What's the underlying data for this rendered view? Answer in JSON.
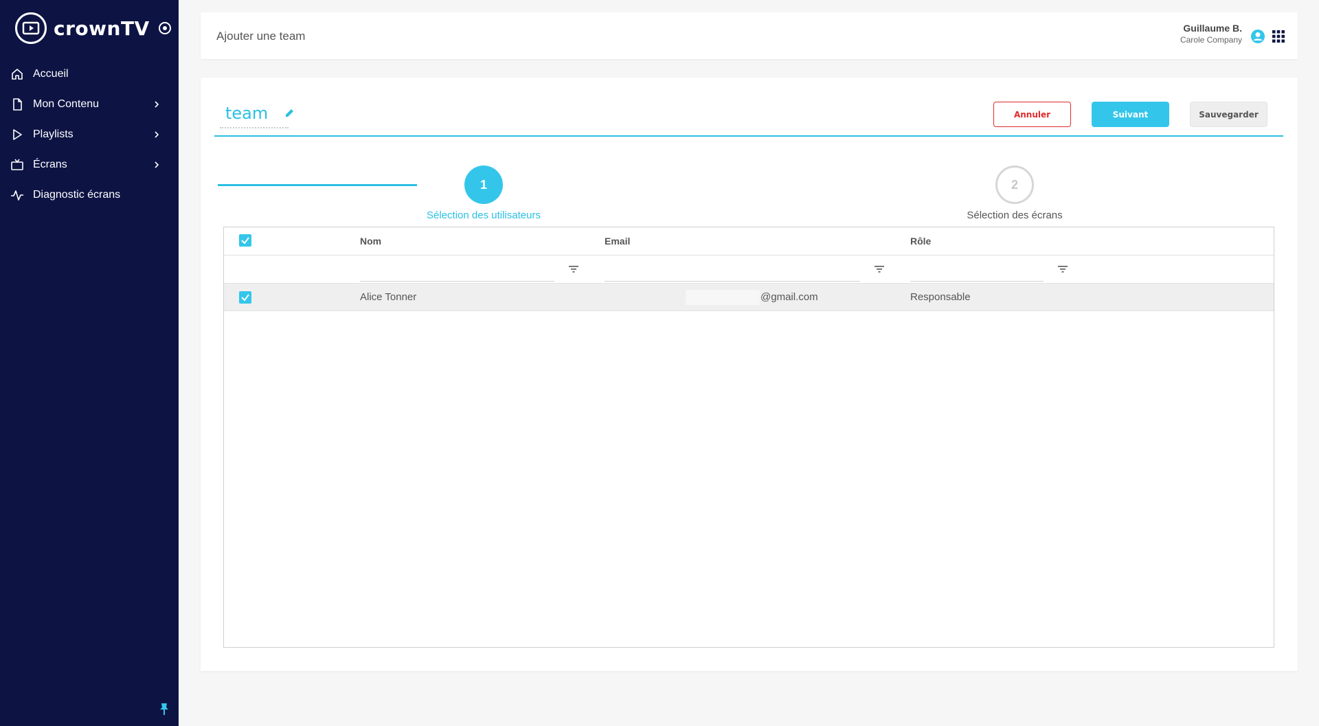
{
  "sidebar": {
    "brand": "crownTV",
    "items": [
      {
        "label": "Accueil",
        "icon": "home-icon"
      },
      {
        "label": "Mon Contenu",
        "icon": "document-icon"
      },
      {
        "label": "Playlists",
        "icon": "play-icon"
      },
      {
        "label": "Écrans",
        "icon": "tv-icon"
      },
      {
        "label": "Diagnostic écrans",
        "icon": "pulse-icon"
      }
    ]
  },
  "header": {
    "title": "Ajouter une team",
    "user_name": "Guillaume B.",
    "company": "Carole Company"
  },
  "team": {
    "name": "team"
  },
  "buttons": {
    "cancel": "Annuler",
    "next": "Suivant",
    "save": "Sauvegarder"
  },
  "stepper": {
    "steps": [
      {
        "number": "1",
        "label": "Sélection des utilisateurs",
        "active": true
      },
      {
        "number": "2",
        "label": "Sélection des écrans",
        "active": false
      }
    ]
  },
  "table": {
    "columns": [
      "Nom",
      "Email",
      "Rôle"
    ],
    "rows": [
      {
        "name": "Alice Tonner",
        "email": "@gmail.com",
        "role": "Responsable",
        "selected": true
      }
    ]
  },
  "colors": {
    "sidebar_bg": "#0d1444",
    "accent": "#34c6ea",
    "danger": "#e02a2a"
  }
}
